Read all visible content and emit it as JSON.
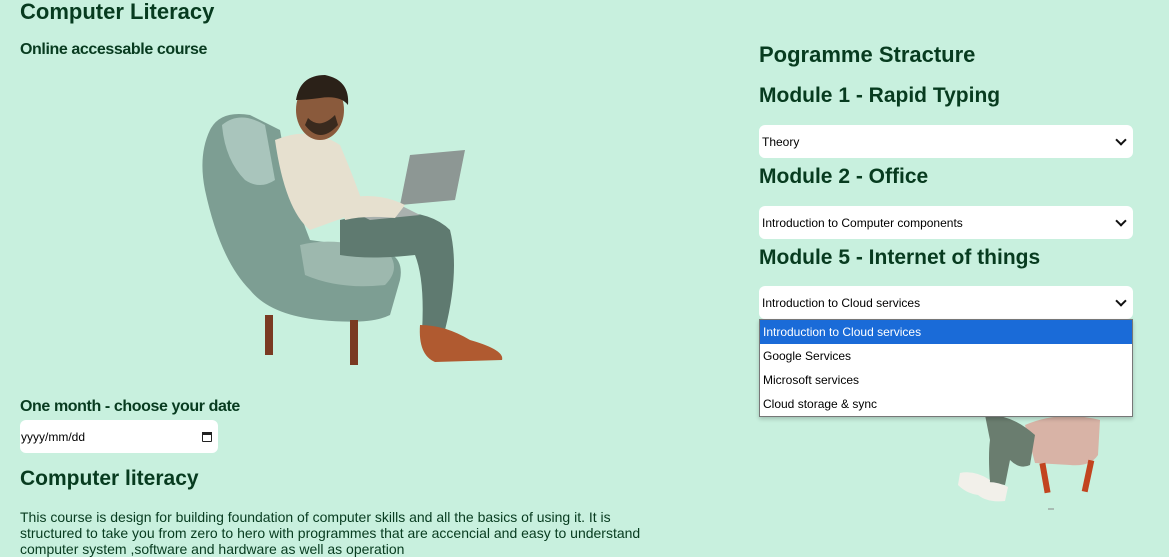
{
  "header": {
    "title": "Computer Literacy",
    "subtitle": "Online accessable course"
  },
  "date": {
    "label": "One month - choose your date",
    "placeholder": "yyyy/mm/dd"
  },
  "about": {
    "heading": "Computer literacy",
    "text": "This course is design for building foundation of computer skills and all the basics of using it. It is structured to take you from zero to hero with programmes that are accencial and easy to understand computer system ,software and hardware as well as operation"
  },
  "programme": {
    "title": "Pogramme Stracture",
    "modules": [
      {
        "heading": "Module 1 - Rapid Typing",
        "selected": "Theory"
      },
      {
        "heading": "Module 2 - Office",
        "selected": "Introduction to Computer components"
      },
      {
        "heading": "Module 5 - Internet of things",
        "selected": "Introduction to Cloud services",
        "options": [
          "Introduction to Cloud services",
          "Google Services",
          "Microsoft services",
          "Cloud storage & sync"
        ]
      }
    ]
  },
  "icons": {
    "dropdown": "chevron-down-icon",
    "calendar": "calendar-icon"
  },
  "colors": {
    "background": "#c8f0de",
    "text": "#073b1f",
    "highlight": "#1a6bd8"
  }
}
